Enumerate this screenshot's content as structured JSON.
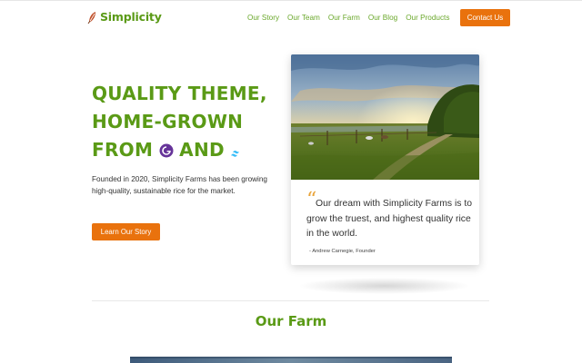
{
  "header": {
    "logo_text": "Simplicity",
    "nav": [
      {
        "label": "Our Story"
      },
      {
        "label": "Our Team"
      },
      {
        "label": "Our Farm"
      },
      {
        "label": "Our Blog"
      },
      {
        "label": "Our Products"
      }
    ],
    "contact_label": "Contact Us"
  },
  "hero": {
    "line1": "QUALITY THEME,",
    "line2": "HOME-GROWN",
    "line3_a": "FROM",
    "line3_b": "AND",
    "description": "Founded in 2020, Simplicity Farms has been growing high-quality, sustainable rice for the market.",
    "cta_label": "Learn Our Story",
    "icons": [
      "gatsby-logo-icon",
      "tailwind-logo-icon"
    ]
  },
  "testimonial": {
    "quote": "Our dream with Simplicity Farms is to grow the truest, and highest quality rice in the world.",
    "author": "- Andrew Carnegie, Founder"
  },
  "farm_section": {
    "title": "Our Farm"
  },
  "colors": {
    "brand_green": "#5a9a16",
    "nav_green": "#6aa82b",
    "accent_orange": "#e9720d",
    "quote_gold": "#e9a43a"
  }
}
